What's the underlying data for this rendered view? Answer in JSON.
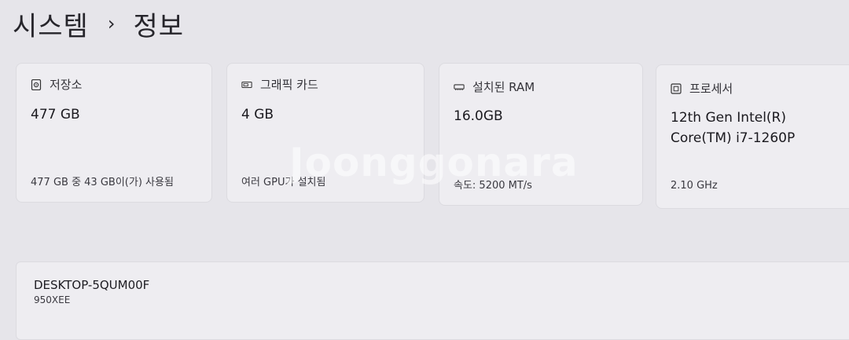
{
  "breadcrumb": {
    "parent": "시스템",
    "separator": "›",
    "current": "정보"
  },
  "cards": [
    {
      "icon": "storage-icon",
      "title": "저장소",
      "value": "477 GB",
      "sub": "477 GB 중 43 GB이(가) 사용됨"
    },
    {
      "icon": "graphics-card-icon",
      "title": "그래픽 카드",
      "value": "4 GB",
      "sub": "여러 GPU가 설치됨"
    },
    {
      "icon": "ram-icon",
      "title": "설치된 RAM",
      "value": "16.0GB",
      "sub": "속도: 5200 MT/s"
    },
    {
      "icon": "processor-icon",
      "title": "프로세서",
      "value_line1": "12th Gen Intel(R)",
      "value_line2": "Core(TM) i7-1260P",
      "sub": "2.10 GHz"
    }
  ],
  "device": {
    "name": "DESKTOP-5QUM00F",
    "model": "950XEE"
  },
  "watermark": "Joonggonara"
}
